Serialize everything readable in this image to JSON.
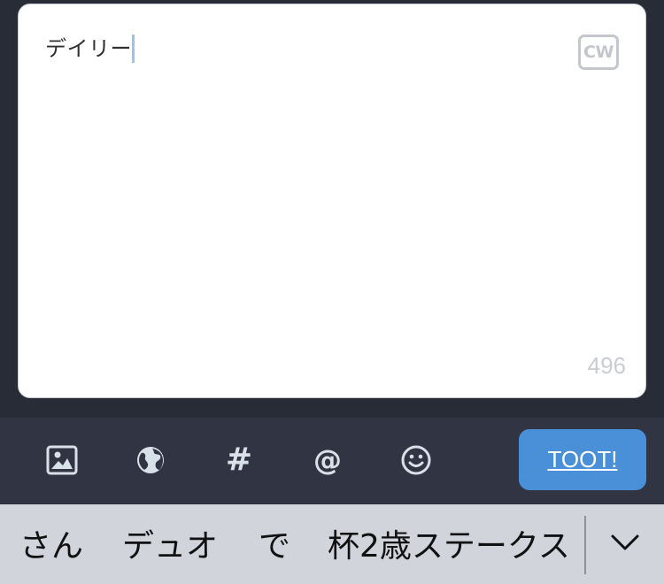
{
  "compose": {
    "text": "デイリー",
    "cw_label": "CW",
    "char_counter": "496"
  },
  "toolbar": {
    "icons": [
      "image-icon",
      "globe-icon",
      "hashtag-icon",
      "mention-icon",
      "emoji-icon"
    ],
    "hashtag_glyph": "#",
    "mention_glyph": "@",
    "toot_label": "TOOT!",
    "accent_color": "#4a90d9"
  },
  "ime": {
    "candidates": [
      "さん",
      "デュオ",
      "で",
      "杯2歳ステークス"
    ],
    "expand_icon": "chevron-down-icon"
  }
}
